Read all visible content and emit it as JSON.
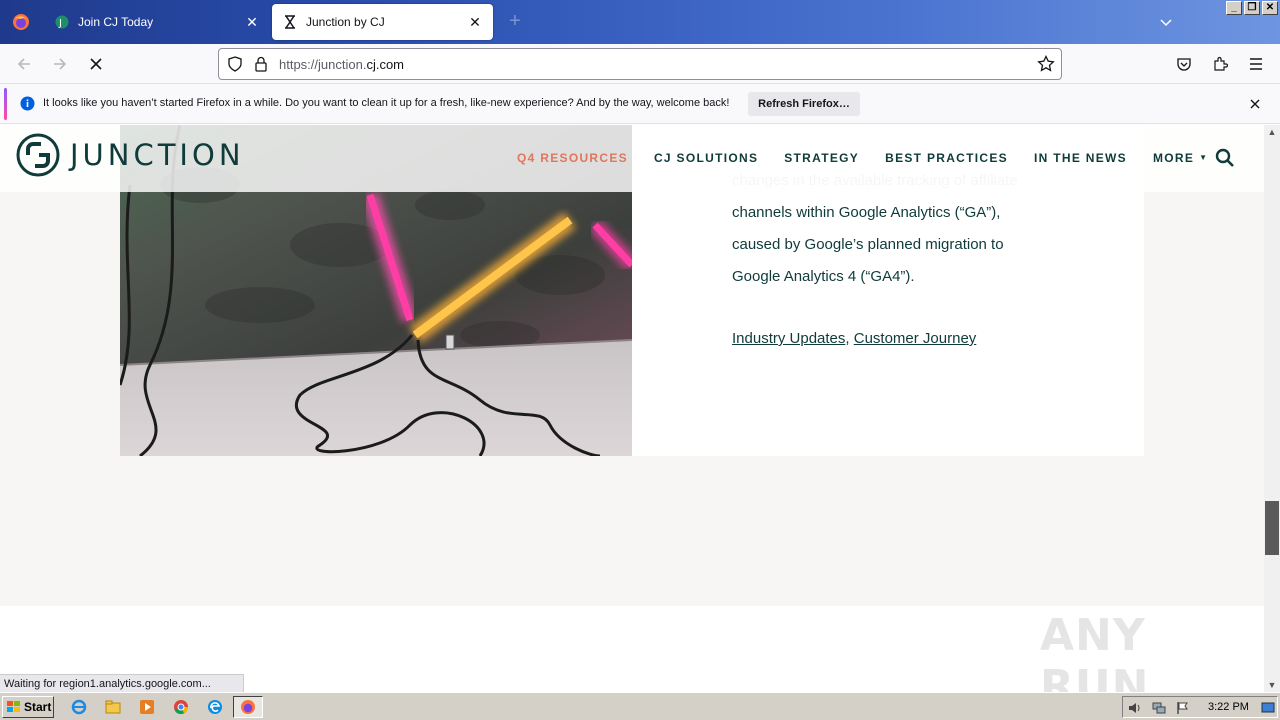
{
  "browser": {
    "tabs": [
      {
        "label": "Join CJ Today",
        "active": false,
        "icon": "cj-favicon-icon"
      },
      {
        "label": "Junction by CJ",
        "active": true,
        "icon": "hourglass-loading-icon"
      }
    ],
    "url_prefix": "https://junction.",
    "url_domain": "cj.com",
    "url_suffix": "",
    "notification": {
      "message": "It looks like you haven’t started Firefox in a while. Do you want to clean it up for a fresh, like-new experience? And by the way, welcome back!",
      "button": "Refresh Firefox…"
    },
    "status": "Waiting for region1.analytics.google.com..."
  },
  "site": {
    "logo_text": "JUNCTION",
    "menu": [
      {
        "label": "Q4 RESOURCES",
        "active": true
      },
      {
        "label": "CJ SOLUTIONS",
        "active": false
      },
      {
        "label": "STRATEGY",
        "active": false
      },
      {
        "label": "BEST PRACTICES",
        "active": false
      },
      {
        "label": "IN THE NEWS",
        "active": false
      },
      {
        "label": "MORE",
        "active": false
      }
    ],
    "article": {
      "lines_faded": [
        "changes in the available tracking of affiliate"
      ],
      "lines": [
        "channels within Google Analytics (“GA”),",
        "caused by Google’s planned migration to",
        "Google Analytics 4 (“GA4”)."
      ],
      "tags": [
        "Industry Updates",
        "Customer Journey"
      ],
      "tag_separator": ","
    },
    "watermark": "ANY RUN",
    "accent_color": "#e2765a",
    "brand_color": "#0f3b3a"
  },
  "taskbar": {
    "start_label": "Start",
    "clock": "3:22 PM"
  }
}
